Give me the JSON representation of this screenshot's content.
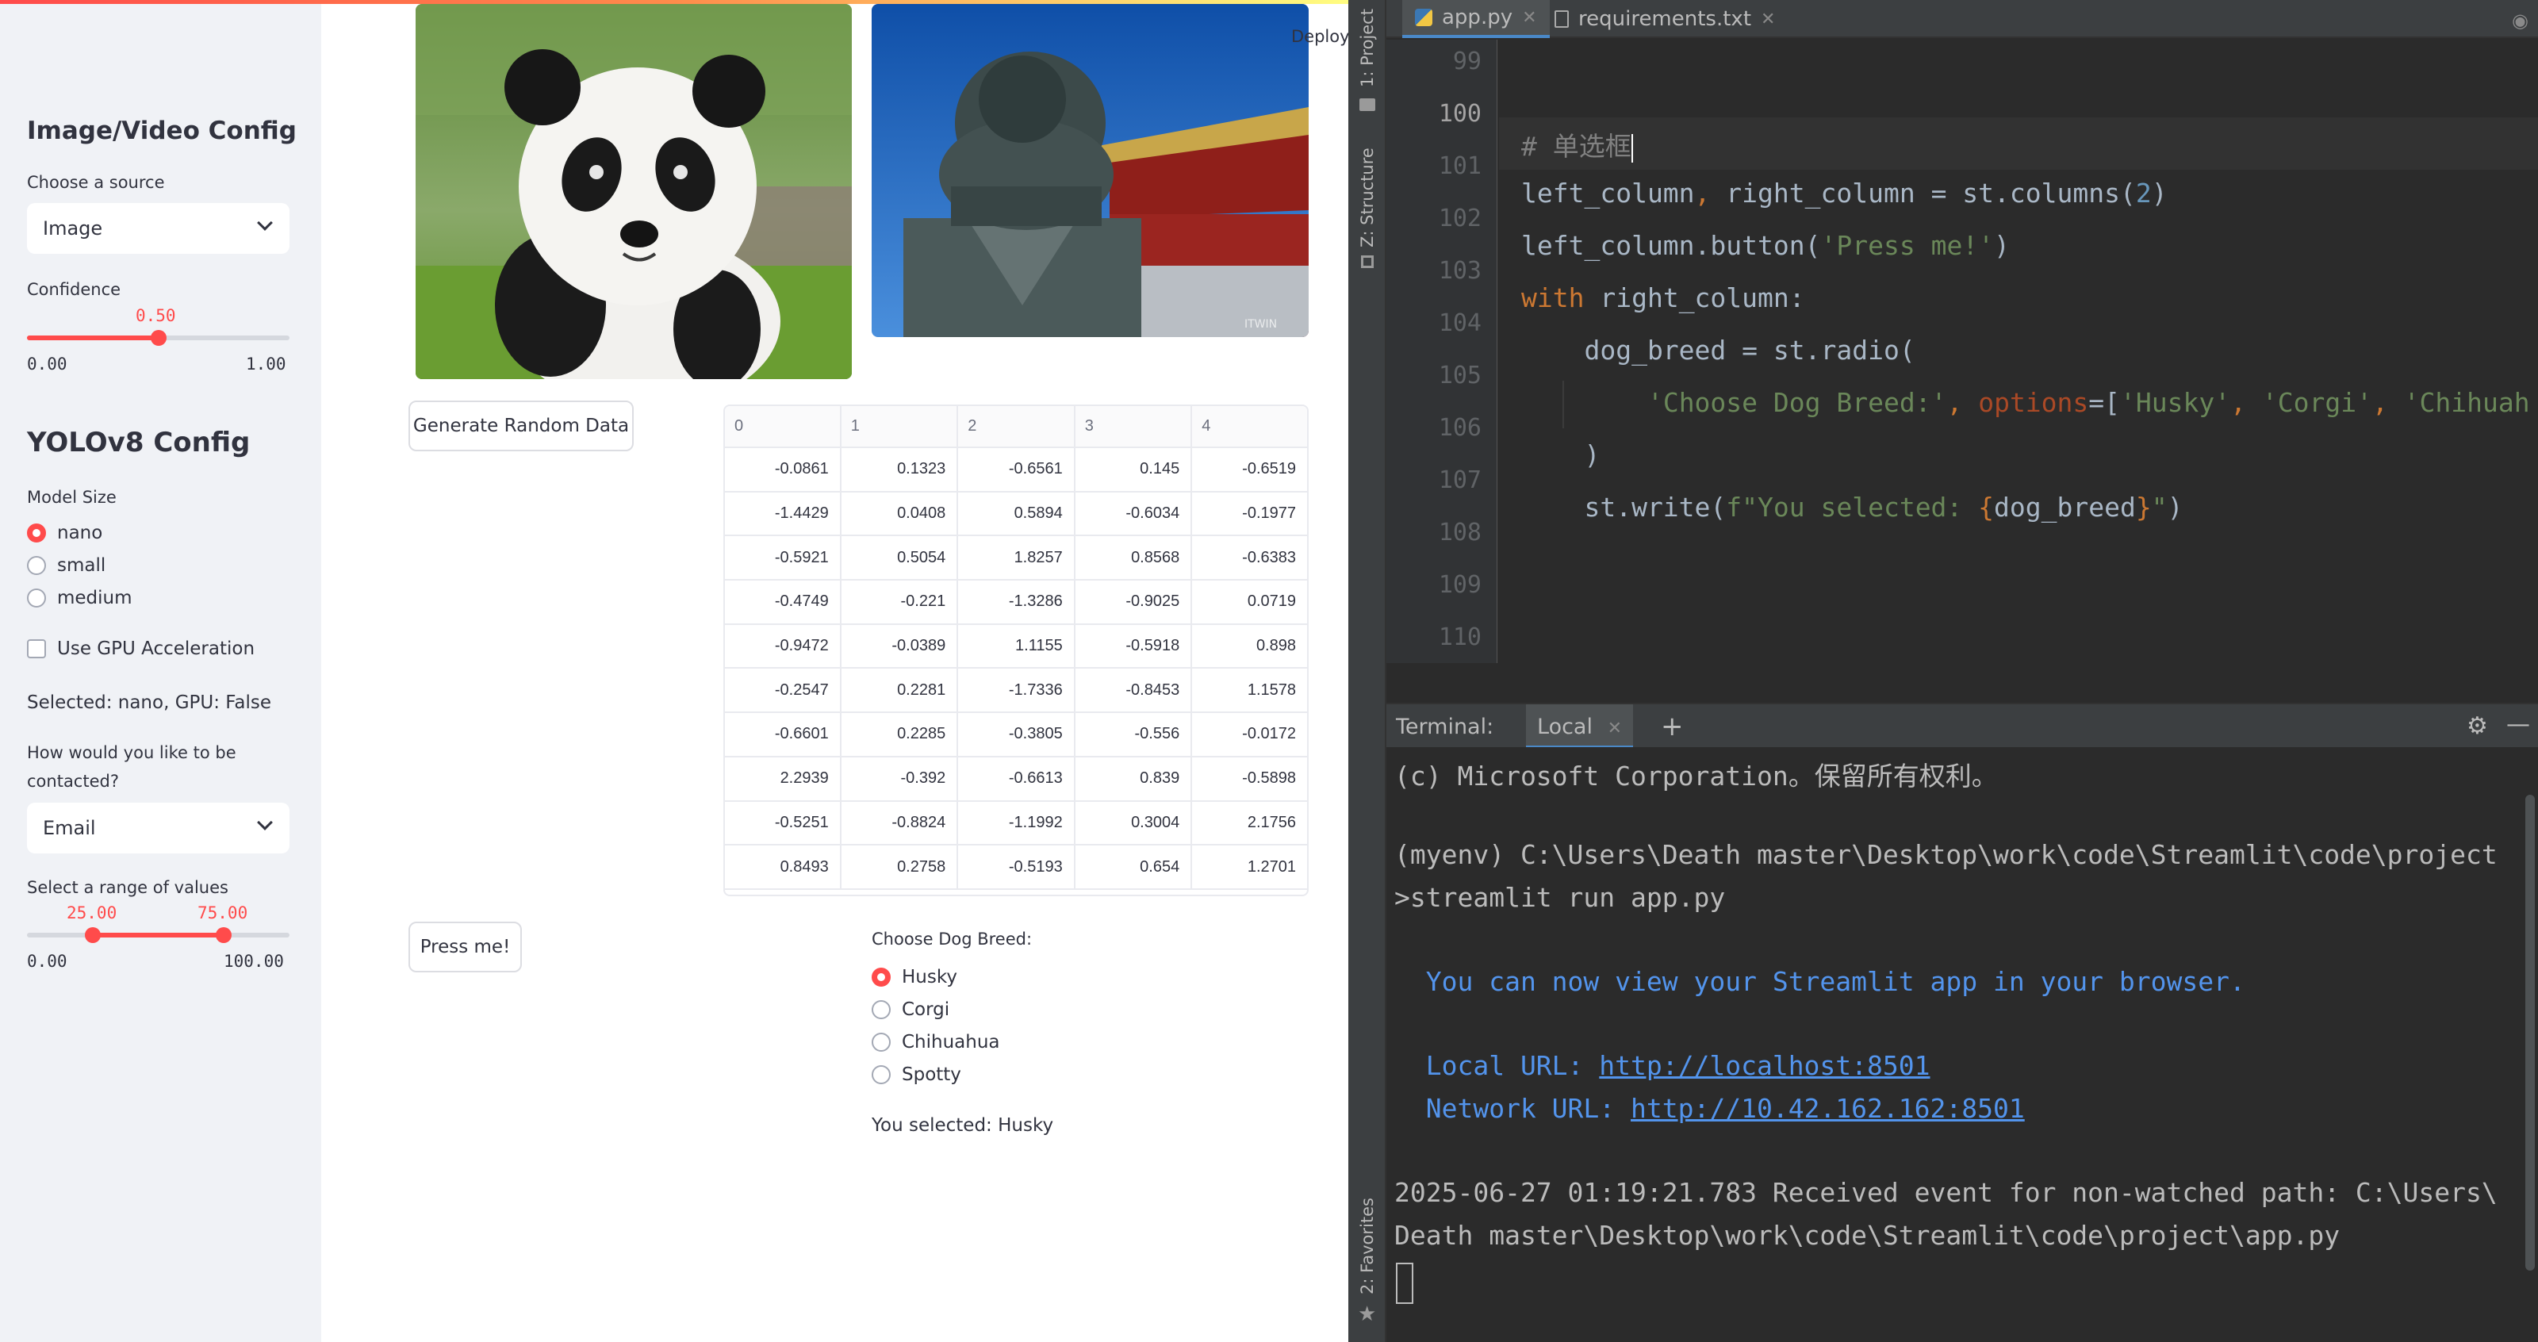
{
  "streamlit": {
    "deploy_label": "Deploy",
    "sidebar": {
      "image_config_heading": "Image/Video Config",
      "source_label": "Choose a source",
      "source_value": "Image",
      "confidence_label": "Confidence",
      "confidence_value": "0.50",
      "confidence_fraction": 0.5,
      "confidence_min": "0.00",
      "confidence_max": "1.00",
      "yolo_heading": "YOLOv8 Config",
      "model_size_label": "Model Size",
      "model_options": [
        "nano",
        "small",
        "medium"
      ],
      "model_selected": "nano",
      "gpu_label": "Use GPU Acceleration",
      "gpu_checked": false,
      "selected_text": "Selected: nano, GPU: False",
      "contact_label_line1": "How would you like to be",
      "contact_label_line2": "contacted?",
      "contact_value": "Email",
      "range_label": "Select a range of values",
      "range_low": "25.00",
      "range_high": "75.00",
      "range_low_fraction": 0.25,
      "range_high_fraction": 0.75,
      "range_min": "0.00",
      "range_max": "100.00"
    },
    "main": {
      "generate_button": "Generate Random Data",
      "table": {
        "columns": [
          "0",
          "1",
          "2",
          "3",
          "4"
        ],
        "rows": [
          [
            "-0.0861",
            "0.1323",
            "-0.6561",
            "0.145",
            "-0.6519"
          ],
          [
            "-1.4429",
            "0.0408",
            "0.5894",
            "-0.6034",
            "-0.1977"
          ],
          [
            "-0.5921",
            "0.5054",
            "1.8257",
            "0.8568",
            "-0.6383"
          ],
          [
            "-0.4749",
            "-0.221",
            "-1.3286",
            "-0.9025",
            "0.0719"
          ],
          [
            "-0.9472",
            "-0.0389",
            "1.1155",
            "-0.5918",
            "0.898"
          ],
          [
            "-0.2547",
            "0.2281",
            "-1.7336",
            "-0.8453",
            "1.1578"
          ],
          [
            "-0.6601",
            "0.2285",
            "-0.3805",
            "-0.556",
            "-0.0172"
          ],
          [
            "2.2939",
            "-0.392",
            "-0.6613",
            "0.839",
            "-0.5898"
          ],
          [
            "-0.5251",
            "-0.8824",
            "-1.1992",
            "0.3004",
            "2.1756"
          ],
          [
            "0.8493",
            "0.2758",
            "-0.5193",
            "0.654",
            "1.2701"
          ]
        ]
      },
      "press_button": "Press me!",
      "dog_label": "Choose Dog Breed:",
      "dog_options": [
        "Husky",
        "Corgi",
        "Chihuahua",
        "Spotty"
      ],
      "dog_selected": "Husky",
      "you_selected": "You selected: Husky"
    }
  },
  "ide": {
    "strip": {
      "project": "1: Project",
      "structure": "Z: Structure",
      "favorites": "2: Favorites"
    },
    "tabs": [
      {
        "label": "app.py",
        "active": true
      },
      {
        "label": "requirements.txt",
        "active": false
      }
    ],
    "line_numbers": [
      "99",
      "100",
      "101",
      "102",
      "103",
      "104",
      "105",
      "106",
      "107",
      "108",
      "109",
      "110"
    ],
    "code": {
      "l100": "# 单选框",
      "l101a": "left_column",
      "l101b": ", ",
      "l101c": "right_column = st.columns(",
      "l101d": "2",
      "l101e": ")",
      "l102a": "left_column.button(",
      "l102b": "'Press me!'",
      "l102c": ")",
      "l103a": "with",
      "l103b": " right_column:",
      "l104": "    dog_breed = st.radio(",
      "l105a": "        ",
      "l105b": "'Choose Dog Breed:'",
      "l105c": ", ",
      "l105d": "options",
      "l105e": "=[",
      "l105f": "'Husky'",
      "l105g": ", ",
      "l105h": "'Corgi'",
      "l105i": ", ",
      "l105j": "'Chihuah",
      "l106": "    )",
      "l107a": "    st.write(",
      "l107b": "f\"You selected: ",
      "l107c": "{",
      "l107d": "dog_breed",
      "l107e": "}",
      "l107f": "\"",
      "l107g": ")"
    },
    "terminal": {
      "title": "Terminal:",
      "tab": "Local",
      "lines": {
        "copyright": "(c) Microsoft Corporation。保留所有权利。",
        "prompt1": "(myenv) C:\\Users\\Death master\\Desktop\\work\\code\\Streamlit\\code\\project",
        "prompt2": ">streamlit run app.py",
        "view": "  You can now view your Streamlit app in your browser.",
        "local_label": "  Local URL: ",
        "local_url": "http://localhost:8501",
        "network_label": "  Network URL: ",
        "network_url": "http://10.42.162.162:8501",
        "event1": "2025-06-27 01:19:21.783 Received event for non-watched path: C:\\Users\\",
        "event2": "Death master\\Desktop\\work\\code\\Streamlit\\code\\project\\app.py"
      }
    }
  }
}
